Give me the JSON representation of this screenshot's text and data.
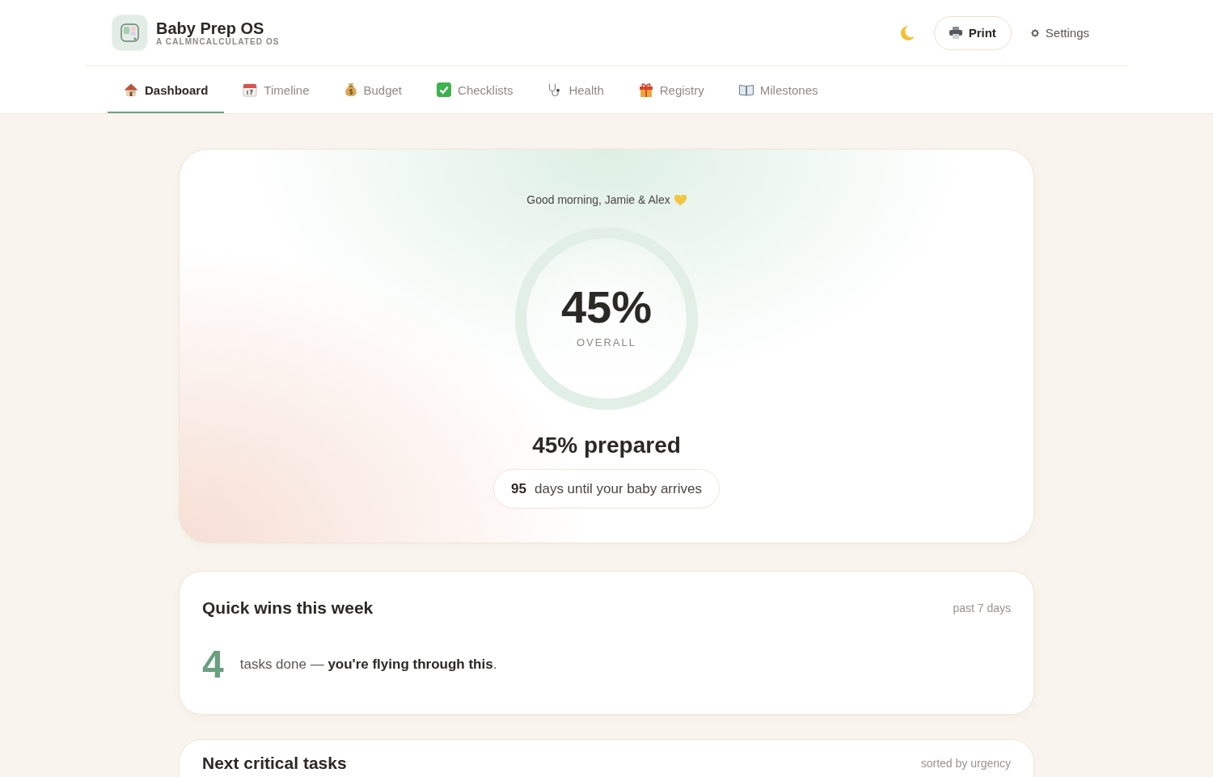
{
  "header": {
    "title": "Baby Prep OS",
    "subtitle": "A CALMNCALCULATED OS",
    "print_button": "Print",
    "settings_link": "Settings"
  },
  "tabs": [
    {
      "label": "Dashboard",
      "selected": true
    },
    {
      "label": "Timeline",
      "selected": false
    },
    {
      "label": "Budget",
      "selected": false
    },
    {
      "label": "Checklists",
      "selected": false
    },
    {
      "label": "Health",
      "selected": false
    },
    {
      "label": "Registry",
      "selected": false
    },
    {
      "label": "Milestones",
      "selected": false
    }
  ],
  "hero": {
    "greeting": "Good morning, Jamie & Alex",
    "overall_value": "45%",
    "overall_label": "OVERALL",
    "prepared_text": "45% prepared",
    "countdown": {
      "days": "95",
      "text": "days until your baby arrives"
    }
  },
  "quick_wins": {
    "title": "Quick wins this week",
    "period": "past 7 days",
    "count": "4",
    "message": "tasks done — **you're flying through this**."
  },
  "critical_tasks": {
    "title": "Next critical tasks",
    "sort_note": "sorted by urgency"
  }
}
